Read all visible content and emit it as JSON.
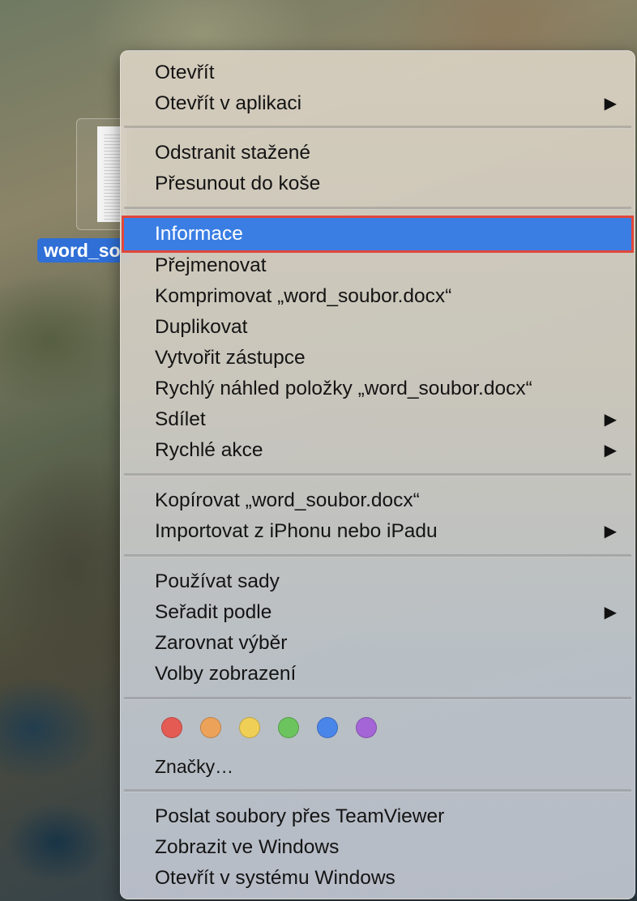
{
  "desktop": {
    "file": {
      "label": "word_so"
    }
  },
  "menu": {
    "groups": [
      [
        {
          "label": "Otevřít",
          "submenu": false
        },
        {
          "label": "Otevřít v aplikaci",
          "submenu": true
        }
      ],
      [
        {
          "label": "Odstranit stažené",
          "submenu": false
        },
        {
          "label": "Přesunout do koše",
          "submenu": false
        }
      ],
      [
        {
          "label": "Informace",
          "submenu": false,
          "highlighted": true
        },
        {
          "label": "Přejmenovat",
          "submenu": false
        },
        {
          "label": "Komprimovat „word_soubor.docx“",
          "submenu": false
        },
        {
          "label": "Duplikovat",
          "submenu": false
        },
        {
          "label": "Vytvořit zástupce",
          "submenu": false
        },
        {
          "label": "Rychlý náhled položky „word_soubor.docx“",
          "submenu": false
        },
        {
          "label": "Sdílet",
          "submenu": true
        },
        {
          "label": "Rychlé akce",
          "submenu": true
        }
      ],
      [
        {
          "label": "Kopírovat „word_soubor.docx“",
          "submenu": false
        },
        {
          "label": "Importovat z iPhonu nebo iPadu",
          "submenu": true
        }
      ],
      [
        {
          "label": "Používat sady",
          "submenu": false
        },
        {
          "label": "Seřadit podle",
          "submenu": true
        },
        {
          "label": "Zarovnat výběr",
          "submenu": false
        },
        {
          "label": "Volby zobrazení",
          "submenu": false
        }
      ],
      [
        {
          "label": "Poslat soubory přes TeamViewer",
          "submenu": false
        },
        {
          "label": "Zobrazit ve Windows",
          "submenu": false
        },
        {
          "label": "Otevřít v systému Windows",
          "submenu": false
        }
      ]
    ],
    "tags": {
      "colors": [
        {
          "name": "red",
          "color": "#e45b54"
        },
        {
          "name": "orange",
          "color": "#eda25a"
        },
        {
          "name": "yellow",
          "color": "#f0cf56"
        },
        {
          "name": "green",
          "color": "#6cc45e"
        },
        {
          "name": "blue",
          "color": "#4a86ea"
        },
        {
          "name": "purple",
          "color": "#a466d6"
        }
      ],
      "label": "Značky…"
    },
    "submenu_arrow": "▶",
    "highlight_color": "#3a7ee4",
    "annotation_color": "#e0473a"
  }
}
